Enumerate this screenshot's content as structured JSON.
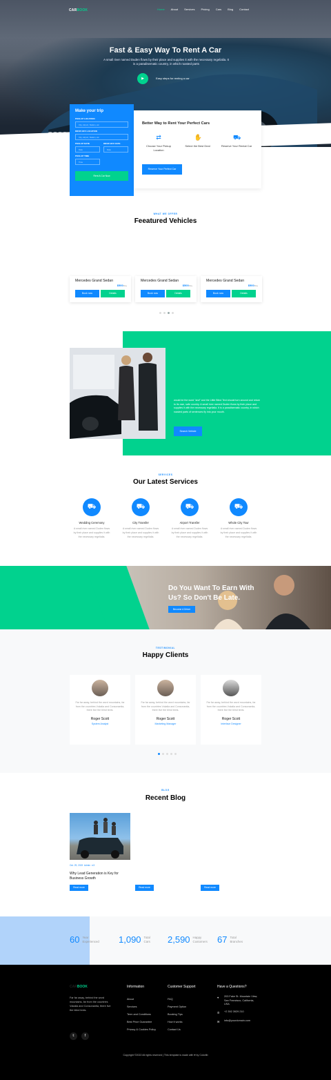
{
  "brand": {
    "part1": "CAR",
    "part2": "BOOK"
  },
  "nav": [
    "Home",
    "About",
    "Services",
    "Pricing",
    "Cars",
    "Blog",
    "Contact"
  ],
  "hero": {
    "title": "Fast & Easy Way To Rent A Car",
    "subtitle": "A small river named Duden flows by their place and supplies it with the necessary regelialia. It is a paradisematic country, in which roasted parts",
    "play_label": "Easy steps for renting a car"
  },
  "trip": {
    "title": "Make your trip",
    "pickup_label": "PICK-UP LOCATION",
    "pickup_ph": "City, Airport, Station, etc",
    "dropoff_label": "DROP-OFF LOCATION",
    "dropoff_ph": "City, Airport, Station, etc",
    "pickup_date_label": "PICK-UP DATE",
    "pickup_date_ph": "Date",
    "dropoff_date_label": "DROP-OFF DATE",
    "dropoff_date_ph": "Date",
    "time_label": "PICK-UP TIME",
    "time_ph": "Time",
    "button": "Rent A Car Now"
  },
  "better": {
    "title": "Better Way to Rent Your Perfect Cars",
    "steps": [
      "Choose Your Pickup Location",
      "Select the Best Deal",
      "Reserve Your Rental Car"
    ],
    "button": "Reserve Your Perfect Car"
  },
  "featured": {
    "eyebrow": "WHAT WE OFFER",
    "title": "Feeatured Vehicles",
    "cars": [
      {
        "name": "Mercedes Grand Sedan",
        "price": "$500",
        "unit": "/day",
        "book": "Book now",
        "details": "Details"
      },
      {
        "name": "Mercedes Grand Sedan",
        "price": "$500",
        "unit": "/day",
        "book": "Book now",
        "details": "Details"
      },
      {
        "name": "Mercedes Grand Sedan",
        "price": "$500",
        "unit": "/day",
        "book": "Book now",
        "details": "Details"
      }
    ]
  },
  "about": {
    "text": "would be the word \"and\" and the Little Blind Text should turn around and return to its own, safe country. A small river named Duden flows by their place and supplies it with the necessary regelialia. It is a paradisematic country, in which roasted parts of sentences fly into your mouth.",
    "button": "Search Vehicle"
  },
  "services": {
    "eyebrow": "SERVICES",
    "title": "Our Latest Services",
    "items": [
      {
        "title": "Wedding Ceremony",
        "desc": "A small river named Duden flows by their place and supplies it with the necessary regelialia."
      },
      {
        "title": "City Transfer",
        "desc": "A small river named Duden flows by their place and supplies it with the necessary regelialia."
      },
      {
        "title": "Airport Transfer",
        "desc": "A small river named Duden flows by their place and supplies it with the necessary regelialia."
      },
      {
        "title": "Whole City Tour",
        "desc": "A small river named Duden flows by their place and supplies it with the necessary regelialia."
      }
    ]
  },
  "driver": {
    "title": "Do You Want To Earn With Us? So Don't Be Late.",
    "button": "Become A Driver"
  },
  "testimonials": {
    "eyebrow": "TESTIMONIAL",
    "title": "Happy Clients",
    "items": [
      {
        "quote": "Far far away, behind the word mountains, far from the countries Vokalia and Consonantia, there live the blind texts.",
        "name": "Roger Scott",
        "role": "System Analyst"
      },
      {
        "quote": "Far far away, behind the word mountains, far from the countries Vokalia and Consonantia, there live the blind texts.",
        "name": "Roger Scott",
        "role": "Marketing Manager"
      },
      {
        "quote": "Far far away, behind the word mountains, far from the countries Vokalia and Consonantia, there live the blind texts.",
        "name": "Roger Scott",
        "role": "Interface Designer"
      }
    ]
  },
  "blog": {
    "eyebrow": "BLOG",
    "title": "Recent Blog",
    "meta_date": "Oct. 29, 2019",
    "meta_author": "Admin",
    "meta_comments": "3",
    "post_title": "Why Lead Generation is Key for Business Growth",
    "read_more": "Read more"
  },
  "counters": [
    {
      "num": "60",
      "label1": "Year",
      "label2": "Experienced"
    },
    {
      "num": "1,090",
      "label1": "Total",
      "label2": "Cars"
    },
    {
      "num": "2,590",
      "label1": "Happy",
      "label2": "Customers"
    },
    {
      "num": "67",
      "label1": "Total",
      "label2": "Branches"
    }
  ],
  "footer": {
    "desc": "Far far away, behind the word mountains, far from the countries Vokalia and Consonantia, there live the blind texts.",
    "info_title": "Information",
    "info_links": [
      "About",
      "Services",
      "Term and Conditions",
      "Best Price Guarantee",
      "Privacy & Cookies Policy"
    ],
    "support_title": "Customer Support",
    "support_links": [
      "FAQ",
      "Payment Option",
      "Booking Tips",
      "How it works",
      "Contact Us"
    ],
    "contact_title": "Have a Questions?",
    "address": "203 Fake St. Mountain View, San Francisco, California, USA",
    "phone": "+2 392 3929 210",
    "email": "info@yourdomain.com",
    "copyright": "Copyright ©2022 All rights reserved | This template is made with ♥ by Colorlib"
  },
  "colors": {
    "primary": "#1089ff",
    "accent": "#01d28e",
    "footer": "#000000"
  }
}
